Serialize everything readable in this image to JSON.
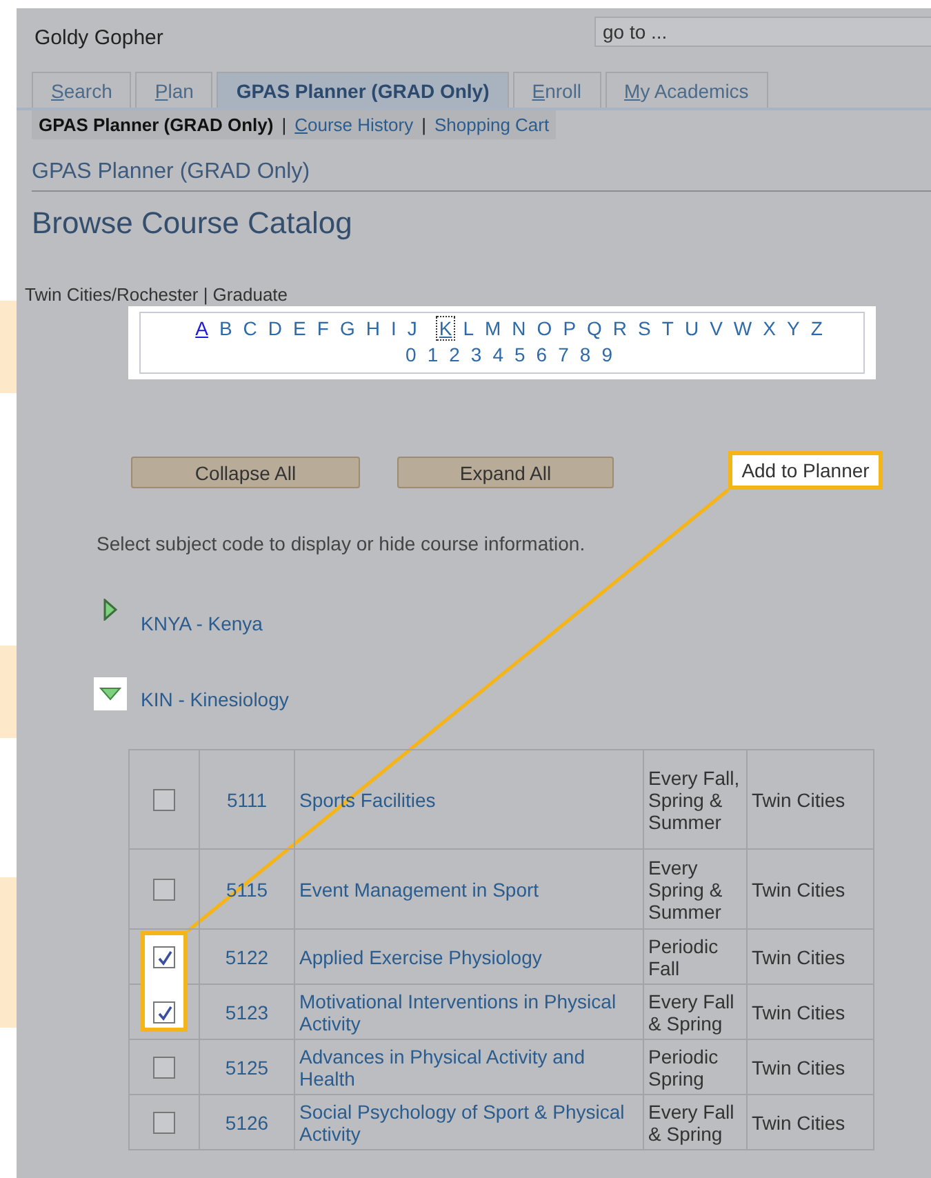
{
  "user": {
    "name": "Goldy Gopher"
  },
  "goto": {
    "placeholder": "go to ..."
  },
  "tabs": [
    {
      "label": "Search",
      "underlined_key": true,
      "selected": false
    },
    {
      "label": "Plan",
      "underlined_key": true,
      "selected": false
    },
    {
      "label": "GPAS Planner (GRAD Only)",
      "underlined_key": false,
      "selected": true
    },
    {
      "label": "Enroll",
      "underlined_key": true,
      "selected": false
    },
    {
      "label": "My Academics",
      "underlined_key": true,
      "selected": false
    }
  ],
  "subnav": [
    {
      "label": "GPAS Planner (GRAD Only)",
      "selected": true,
      "underlined_key": false
    },
    {
      "label": "Course History",
      "selected": false,
      "underlined_key": true
    },
    {
      "label": "Shopping Cart",
      "selected": false,
      "underlined_key": false
    }
  ],
  "subnav_separator": "|",
  "section_title": "GPAS Planner (GRAD Only)",
  "page_title": "Browse Course Catalog",
  "campus_line": "Twin Cities/Rochester | Graduate",
  "letters": [
    {
      "label": "A",
      "visited": true,
      "focused": false
    },
    {
      "label": "B",
      "visited": false,
      "focused": false
    },
    {
      "label": "C",
      "visited": false,
      "focused": false
    },
    {
      "label": "D",
      "visited": false,
      "focused": false
    },
    {
      "label": "E",
      "visited": false,
      "focused": false
    },
    {
      "label": "F",
      "visited": false,
      "focused": false
    },
    {
      "label": "G",
      "visited": false,
      "focused": false
    },
    {
      "label": "H",
      "visited": false,
      "focused": false
    },
    {
      "label": "I",
      "visited": false,
      "focused": false
    },
    {
      "label": "J",
      "visited": false,
      "focused": false
    },
    {
      "label": "K",
      "visited": false,
      "focused": true
    },
    {
      "label": "L",
      "visited": false,
      "focused": false
    },
    {
      "label": "M",
      "visited": false,
      "focused": false
    },
    {
      "label": "N",
      "visited": false,
      "focused": false
    },
    {
      "label": "O",
      "visited": false,
      "focused": false
    },
    {
      "label": "P",
      "visited": false,
      "focused": false
    },
    {
      "label": "Q",
      "visited": false,
      "focused": false
    },
    {
      "label": "R",
      "visited": false,
      "focused": false
    },
    {
      "label": "S",
      "visited": false,
      "focused": false
    },
    {
      "label": "T",
      "visited": false,
      "focused": false
    },
    {
      "label": "U",
      "visited": false,
      "focused": false
    },
    {
      "label": "V",
      "visited": false,
      "focused": false
    },
    {
      "label": "W",
      "visited": false,
      "focused": false
    },
    {
      "label": "X",
      "visited": false,
      "focused": false
    },
    {
      "label": "Y",
      "visited": false,
      "focused": false
    },
    {
      "label": "Z",
      "visited": false,
      "focused": false
    }
  ],
  "digits": [
    "0",
    "1",
    "2",
    "3",
    "4",
    "5",
    "6",
    "7",
    "8",
    "9"
  ],
  "buttons": [
    "Collapse All",
    "Expand All"
  ],
  "callout": {
    "label": "Add to Planner"
  },
  "instruction": "Select subject code to display or hide course information.",
  "subjects": [
    {
      "label": "KNYA - Kenya",
      "expanded": false
    },
    {
      "label": "KIN - Kinesiology",
      "expanded": true
    }
  ],
  "courses": [
    {
      "checked": false,
      "number": "5111",
      "title": "Sports Facilities",
      "term": "Every Fall, Spring & Summer",
      "campus": "Twin Cities"
    },
    {
      "checked": false,
      "number": "5115",
      "title": "Event Management in Sport",
      "term": "Every Spring & Summer",
      "campus": "Twin Cities"
    },
    {
      "checked": true,
      "number": "5122",
      "title": "Applied Exercise Physiology",
      "term": "Periodic Fall",
      "campus": "Twin Cities"
    },
    {
      "checked": true,
      "number": "5123",
      "title": "Motivational Interventions in Physical Activity",
      "term": "Every Fall & Spring",
      "campus": "Twin Cities"
    },
    {
      "checked": false,
      "number": "5125",
      "title": "Advances in Physical Activity and Health",
      "term": "Periodic Spring",
      "campus": "Twin Cities"
    },
    {
      "checked": false,
      "number": "5126",
      "title": "Social Psychology of Sport & Physical Activity",
      "term": "Every Fall & Spring",
      "campus": "Twin Cities"
    }
  ]
}
